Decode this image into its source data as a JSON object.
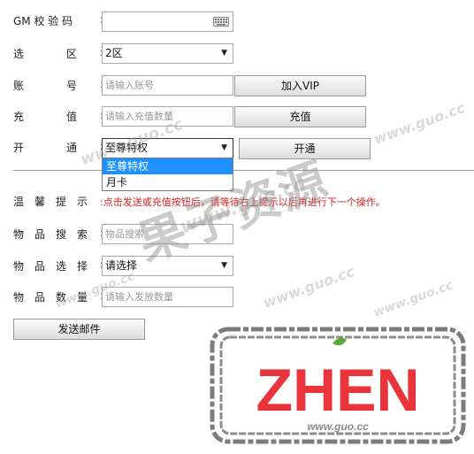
{
  "form": {
    "gm_code": {
      "label": "GM 校 验 码",
      "value": ""
    },
    "zone": {
      "label_chars": [
        "选",
        "区"
      ],
      "selected": "2区"
    },
    "account": {
      "label_chars": [
        "账",
        "号"
      ],
      "placeholder": "请输入账号",
      "button": "加入VIP"
    },
    "recharge": {
      "label_chars": [
        "充",
        "值"
      ],
      "placeholder": "请输入充值数量",
      "button": "充值"
    },
    "activate": {
      "label_chars": [
        "开",
        "通"
      ],
      "selected": "至尊特权",
      "options": [
        "至尊特权",
        "月卡"
      ],
      "button": "开通"
    },
    "tip": {
      "label_chars": [
        "温",
        "馨",
        "提",
        "示"
      ],
      "text": "点击发送或充值按钮后，请等待右上提示以后再进行下一个操作。"
    },
    "item_search": {
      "label_chars": [
        "物",
        "品",
        "搜",
        "索"
      ],
      "placeholder": "物品搜索"
    },
    "item_select": {
      "label_chars": [
        "物",
        "品",
        "选",
        "择"
      ],
      "selected": "请选择"
    },
    "item_qty": {
      "label_chars": [
        "物",
        "品",
        "数",
        "量"
      ],
      "placeholder": "请输入发放数量"
    },
    "send_button": "发送邮件"
  },
  "watermark": {
    "url": "www.guo.cc",
    "text": "果子资源",
    "stamp": "ZHEN",
    "stamp_url": "www.guo.cc"
  },
  "colors": {
    "warning": "#e02020",
    "selected_option": "#1e90ff",
    "stamp": "#e8343a"
  },
  "icons": {
    "keyboard": "keyboard-icon",
    "dropdown": "chevron-down-icon"
  }
}
